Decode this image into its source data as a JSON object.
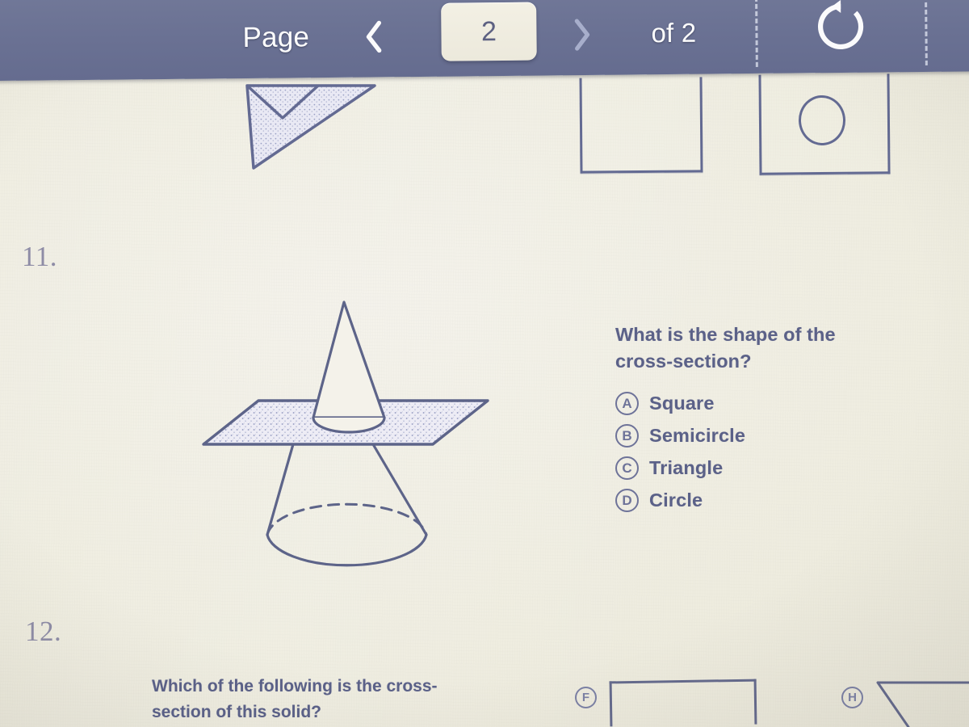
{
  "toolbar": {
    "page_label": "Page",
    "prev_icon": "chevron-left-icon",
    "current_page": "2",
    "next_icon": "chevron-right-icon",
    "of_label": "of 2",
    "total_pages": "2",
    "refresh_icon": "refresh-icon",
    "bg_color": "#6a7193",
    "text_color": "#fdfdfd",
    "input_bg": "#efecdf"
  },
  "worksheet": {
    "paper_color": "#eeecdf",
    "ink_color": "#5b6188",
    "number_color": "#8e8ca6",
    "cutoff_shapes": {
      "plane_icon": "shaded-plane-shape",
      "box_1_icon": "empty-rectangle-shape",
      "box_2_icon": "rectangle-with-circle-shape"
    },
    "question_11": {
      "number": "11.",
      "figure_icon": "cone-with-horizontal-cross-section-plane",
      "prompt": "What is the shape of the cross-section?",
      "choices": [
        {
          "letter": "A",
          "text": "Square"
        },
        {
          "letter": "B",
          "text": "Semicircle"
        },
        {
          "letter": "C",
          "text": "Triangle"
        },
        {
          "letter": "D",
          "text": "Circle"
        }
      ]
    },
    "question_12": {
      "number": "12.",
      "prompt": "Which of the following is the cross-section of this solid?",
      "choices": [
        {
          "letter": "F",
          "shape_icon": "rectangle-shape"
        },
        {
          "letter": "H",
          "shape_icon": "trapezoid-shape"
        }
      ]
    }
  }
}
